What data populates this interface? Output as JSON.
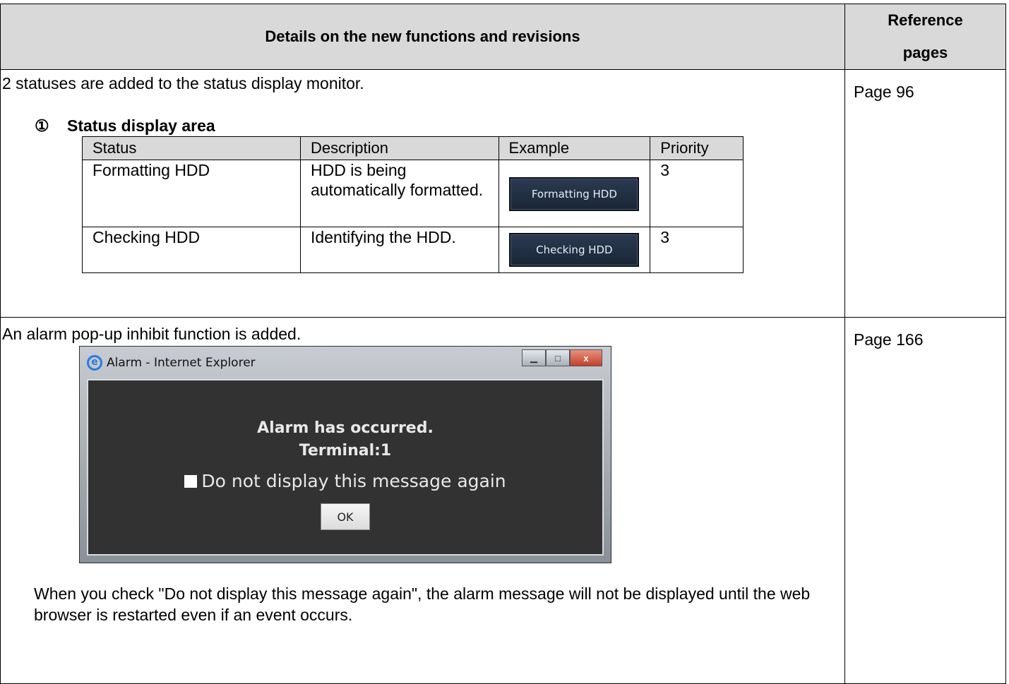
{
  "header": {
    "details": "Details on the new functions and revisions",
    "ref_line1": "Reference",
    "ref_line2": "pages"
  },
  "row1": {
    "intro": "2 statuses are added to the status display monitor.",
    "section_marker": "①",
    "section_title": "Status display area",
    "reference": "Page 96",
    "status_table": {
      "headers": [
        "Status",
        "Description",
        "Example",
        "Priority"
      ],
      "rows": [
        {
          "status": "Formatting HDD",
          "description": "HDD is being automatically formatted.",
          "example": "Formatting HDD",
          "priority": "3"
        },
        {
          "status": "Checking HDD",
          "description": "Identifying the HDD.",
          "example": "Checking HDD",
          "priority": "3"
        }
      ]
    }
  },
  "row2": {
    "intro": "An alarm pop-up inhibit function is added.",
    "reference": "Page 166",
    "popup": {
      "window_title": "Alarm - Internet Explorer",
      "message_line1": "Alarm has occurred.",
      "message_line2": "Terminal:1",
      "checkbox_label": "Do not display this message again",
      "checkbox_checked": false,
      "ok_label": "OK",
      "close_glyph": "x"
    },
    "note": "When you check \"Do not display this message again\", the alarm message will not be displayed until the web browser is restarted even if an event occurs."
  }
}
